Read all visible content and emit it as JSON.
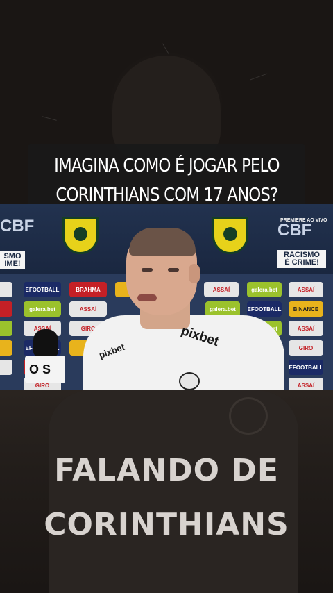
{
  "caption": {
    "line1": "IMAGINA COMO É JOGAR PELO",
    "line2": "CORINTHIANS COM 17 ANOS?"
  },
  "video": {
    "cbf_left": "CBF",
    "cbf_right": "CBF",
    "racismo_left": "SMO\nIME!",
    "racismo_right": "RACISMO\nÉ CRIME!",
    "premiere": "PREMIERE\nAO VIVO",
    "ads": [
      "BRAHMA",
      "ASSAÍ",
      "galera.bet",
      "BINANCE",
      "EFOOTBALL",
      "GIRO"
    ],
    "shirt_sponsor": "pixbet",
    "mic_logo": "O S"
  },
  "footer": {
    "line1": "FALANDO DE",
    "line2": "CORINTHIANS"
  },
  "colors": {
    "caption_bg": "#191919",
    "title_text": "#d8d3cf",
    "logo_yellow": "#e7d21a"
  }
}
